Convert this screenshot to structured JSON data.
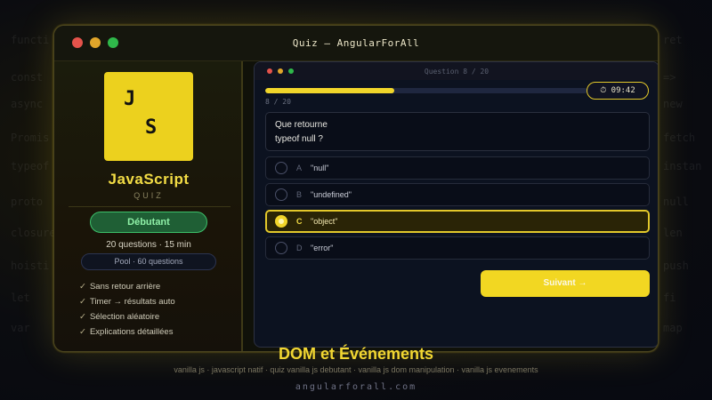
{
  "window": {
    "title": "Quiz — AngularForAll"
  },
  "quiz_card": {
    "logo_line1": "J",
    "logo_line2": "S",
    "name": "JavaScript",
    "subtitle": "QUIZ",
    "level": "Débutant",
    "meta": "20 questions · 15 min",
    "pool": "Pool · 60 questions",
    "features": [
      "Sans retour arrière",
      "Timer → résultats auto",
      "Sélection aléatoire",
      "Explications détaillées"
    ],
    "check_glyph": "✓"
  },
  "quiz": {
    "counter": "Question 8 / 20",
    "progress_text": "8 / 20",
    "progress": {
      "current": 8,
      "total": 20
    },
    "timer": "⏱ 09:42",
    "question_line1": "Que retourne",
    "question_line2": "typeof null ?",
    "options": [
      {
        "letter": "A",
        "text": "\"null\"",
        "selected": false
      },
      {
        "letter": "B",
        "text": "\"undefined\"",
        "selected": false
      },
      {
        "letter": "C",
        "text": "\"object\"",
        "selected": true
      },
      {
        "letter": "D",
        "text": "\"error\"",
        "selected": false
      }
    ],
    "next_label": "Suivant →"
  },
  "footer": {
    "title": "DOM et Événements",
    "tags": "vanilla js · javascript natif · quiz vanilla js debutant · vanilla js dom manipulation · vanilla js evenements",
    "site": "angularforall.com"
  },
  "background_code": {
    "left": [
      "functi",
      "const",
      "async",
      "Promis",
      "typeof",
      "proto",
      "closure",
      "hoisti",
      "let",
      "var"
    ],
    "right": [
      "ret",
      "=>",
      "new",
      "fetch",
      "instan",
      "null",
      "len",
      "push",
      "fi",
      "map"
    ]
  },
  "colors": {
    "accent": "#f2d722",
    "level_green": "#3cc06a",
    "window_bg": "#101109",
    "panel_bg": "#0c1220"
  }
}
